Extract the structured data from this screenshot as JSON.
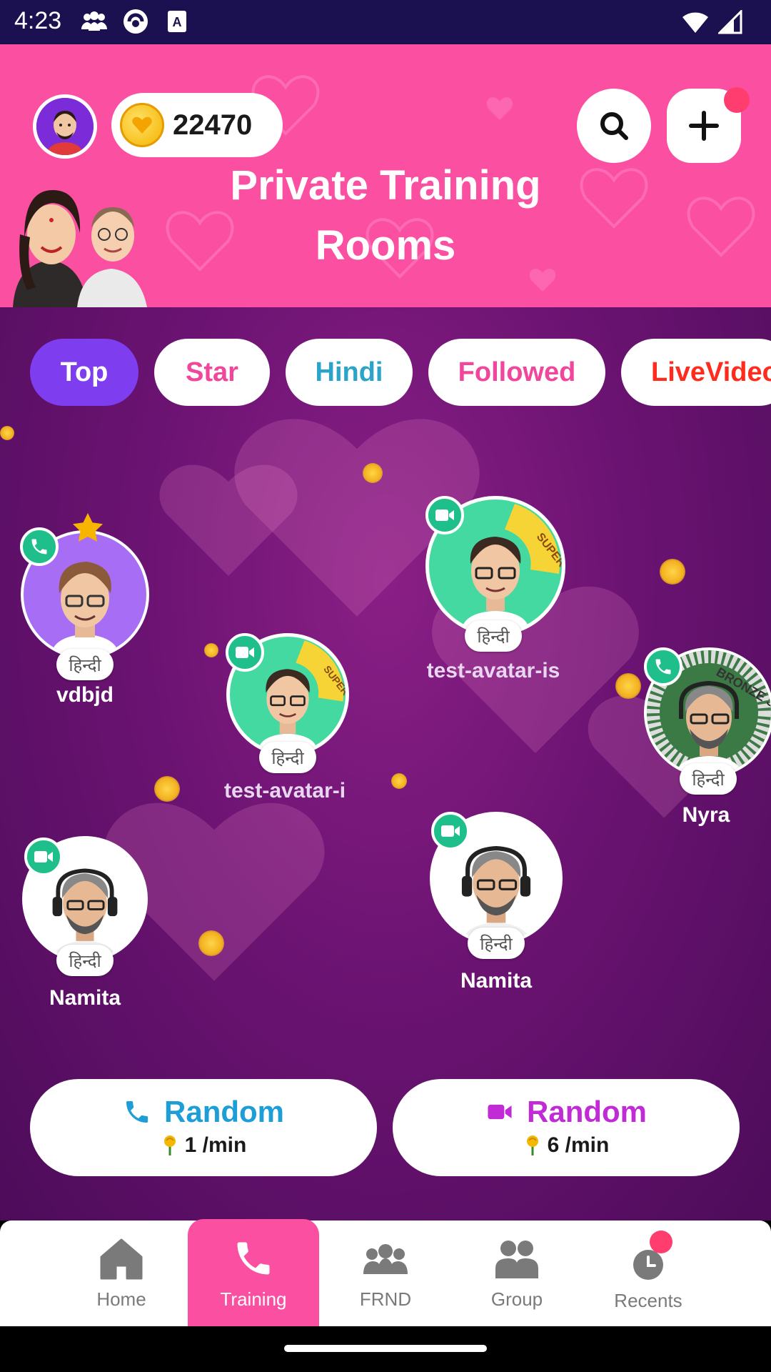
{
  "status_bar": {
    "time": "4:23"
  },
  "header": {
    "coins": "22470",
    "title_line1": "Private Training",
    "title_line2": "Rooms"
  },
  "filters": [
    {
      "label": "Top",
      "active": true
    },
    {
      "label": "Star",
      "active": false
    },
    {
      "label": "Hindi",
      "active": false
    },
    {
      "label": "Followed",
      "active": false
    },
    {
      "label": "LiveVideo",
      "active": false
    }
  ],
  "users": [
    {
      "name": "vdbjd",
      "language": "हिन्दी",
      "call_type": "audio",
      "starred": true
    },
    {
      "name": "test-avatar-is",
      "language": "हिन्दी",
      "call_type": "video",
      "badge": "SUPER FRND"
    },
    {
      "name": "test-avatar-i",
      "language": "हिन्दी",
      "call_type": "video",
      "badge": "SUPER FRND"
    },
    {
      "name": "Nyra",
      "language": "हिन्दी",
      "call_type": "audio",
      "badge": "BRONZE SUPER FR"
    },
    {
      "name": "Namita",
      "language": "हिन्दी",
      "call_type": "video"
    },
    {
      "name": "Namita",
      "language": "हिन्दी",
      "call_type": "video"
    }
  ],
  "random_audio": {
    "label": "Random",
    "rate": "1 /min"
  },
  "random_video": {
    "label": "Random",
    "rate": "6 /min"
  },
  "nav": {
    "home": "Home",
    "training": "Training",
    "frnd": "FRND",
    "group": "Group",
    "recents": "Recents"
  },
  "colors": {
    "header_pink": "#fb4fa2",
    "accent_purple": "#7f3df0",
    "call_green": "#1fbf8c",
    "audio_blue": "#1d9ed6",
    "video_magenta": "#c02bd6"
  }
}
